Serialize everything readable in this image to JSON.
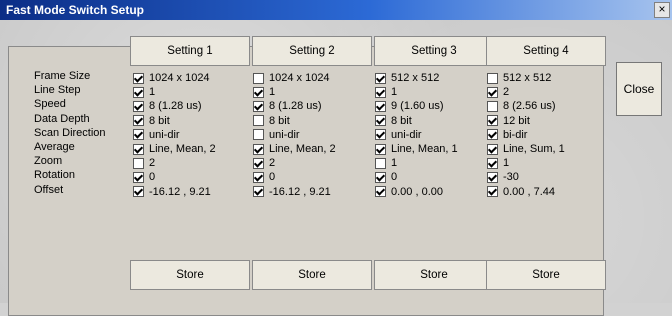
{
  "window": {
    "title": "Fast Mode Switch Setup",
    "close_glyph": "×"
  },
  "close_label": "Close",
  "settings": [
    "Setting 1",
    "Setting 2",
    "Setting 3",
    "Setting 4"
  ],
  "store_label": "Store",
  "rows": [
    "Frame Size",
    "Line Step",
    "Speed",
    "Data Depth",
    "Scan Direction",
    "Average",
    "Zoom",
    "Rotation",
    "Offset"
  ],
  "grid": [
    [
      {
        "checked": true,
        "value": "1024 x 1024"
      },
      {
        "checked": true,
        "value": "1"
      },
      {
        "checked": true,
        "value": "8 (1.28 us)"
      },
      {
        "checked": true,
        "value": "8 bit"
      },
      {
        "checked": true,
        "value": "uni-dir"
      },
      {
        "checked": true,
        "value": "Line, Mean, 2"
      },
      {
        "checked": false,
        "value": "2"
      },
      {
        "checked": true,
        "value": "0"
      },
      {
        "checked": true,
        "value": "-16.12 , 9.21"
      }
    ],
    [
      {
        "checked": false,
        "value": "1024 x 1024"
      },
      {
        "checked": true,
        "value": "1"
      },
      {
        "checked": true,
        "value": "8 (1.28 us)"
      },
      {
        "checked": false,
        "value": "8 bit"
      },
      {
        "checked": false,
        "value": "uni-dir"
      },
      {
        "checked": true,
        "value": "Line, Mean, 2"
      },
      {
        "checked": true,
        "value": "2"
      },
      {
        "checked": true,
        "value": "0"
      },
      {
        "checked": true,
        "value": "-16.12 , 9.21"
      }
    ],
    [
      {
        "checked": true,
        "value": "512 x 512"
      },
      {
        "checked": true,
        "value": "1"
      },
      {
        "checked": true,
        "value": "9 (1.60 us)"
      },
      {
        "checked": true,
        "value": "8 bit"
      },
      {
        "checked": true,
        "value": "uni-dir"
      },
      {
        "checked": true,
        "value": "Line, Mean, 1"
      },
      {
        "checked": false,
        "value": "1"
      },
      {
        "checked": true,
        "value": "0"
      },
      {
        "checked": true,
        "value": "0.00 , 0.00"
      }
    ],
    [
      {
        "checked": false,
        "value": "512 x 512"
      },
      {
        "checked": true,
        "value": "2"
      },
      {
        "checked": false,
        "value": "8 (2.56 us)"
      },
      {
        "checked": true,
        "value": "12 bit"
      },
      {
        "checked": true,
        "value": "bi-dir"
      },
      {
        "checked": true,
        "value": "Line, Sum, 1"
      },
      {
        "checked": true,
        "value": "1"
      },
      {
        "checked": true,
        "value": "-30"
      },
      {
        "checked": true,
        "value": "0.00 , 7.44"
      }
    ]
  ]
}
